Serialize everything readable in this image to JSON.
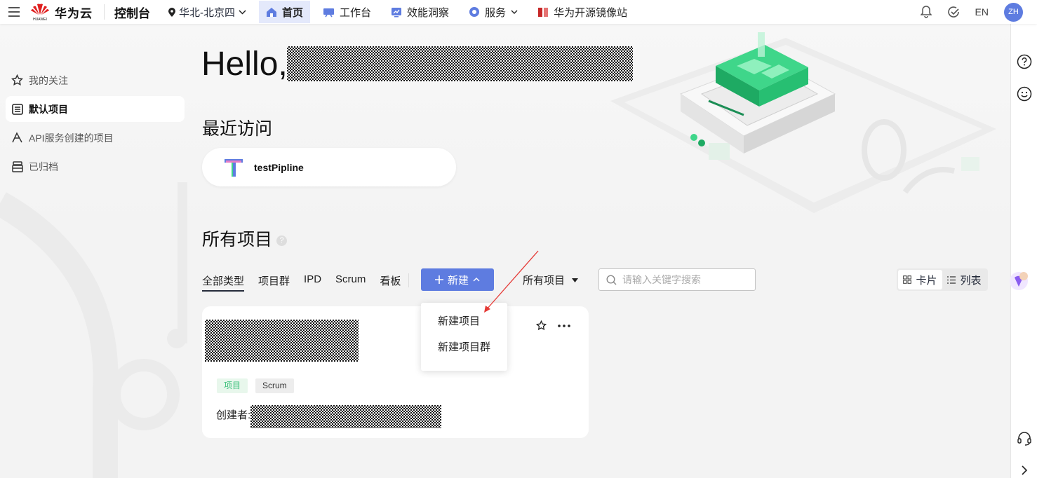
{
  "topbar": {
    "brand_name": "华为云",
    "brand_sub": "HUAWEI",
    "console_label": "控制台",
    "region_label": "华北-北京四",
    "nav": [
      {
        "label": "首页",
        "active": true
      },
      {
        "label": "工作台",
        "active": false
      },
      {
        "label": "效能洞察",
        "active": false
      },
      {
        "label": "服务",
        "active": false
      },
      {
        "label": "华为开源镜像站",
        "active": false
      }
    ],
    "lang_label": "EN",
    "avatar_initials": "ZH"
  },
  "sidebar": {
    "items": [
      {
        "label": "我的关注",
        "icon": "star-icon",
        "active": false
      },
      {
        "label": "默认项目",
        "icon": "list-icon",
        "active": true
      },
      {
        "label": "API服务创建的项目",
        "icon": "api-icon",
        "active": false
      },
      {
        "label": "已归档",
        "icon": "archive-icon",
        "active": false
      }
    ]
  },
  "main": {
    "greeting": "Hello,",
    "recent_title": "最近访问",
    "recent_items": [
      {
        "name": "testPipline"
      }
    ],
    "all_projects_title": "所有项目",
    "type_tabs": [
      {
        "label": "全部类型",
        "active": true
      },
      {
        "label": "项目群",
        "active": false
      },
      {
        "label": "IPD",
        "active": false
      },
      {
        "label": "Scrum",
        "active": false
      },
      {
        "label": "看板",
        "active": false
      }
    ],
    "new_button_label": "新建",
    "filter_label": "所有项目",
    "search_placeholder": "请输入关键字搜索",
    "view_card_label": "卡片",
    "view_list_label": "列表",
    "new_menu": [
      {
        "label": "新建项目"
      },
      {
        "label": "新建项目群"
      }
    ],
    "project_card": {
      "tags": [
        "项目",
        "Scrum"
      ],
      "creator_label": "创建者:"
    }
  },
  "colors": {
    "accent": "#5e7ce0",
    "nav_active_bg": "#e4e9fb",
    "tag_green_text": "#3ac07a",
    "tag_green_bg": "#e8f7ec",
    "annotation_arrow": "#e53935",
    "huawei_red": "#e02020"
  }
}
